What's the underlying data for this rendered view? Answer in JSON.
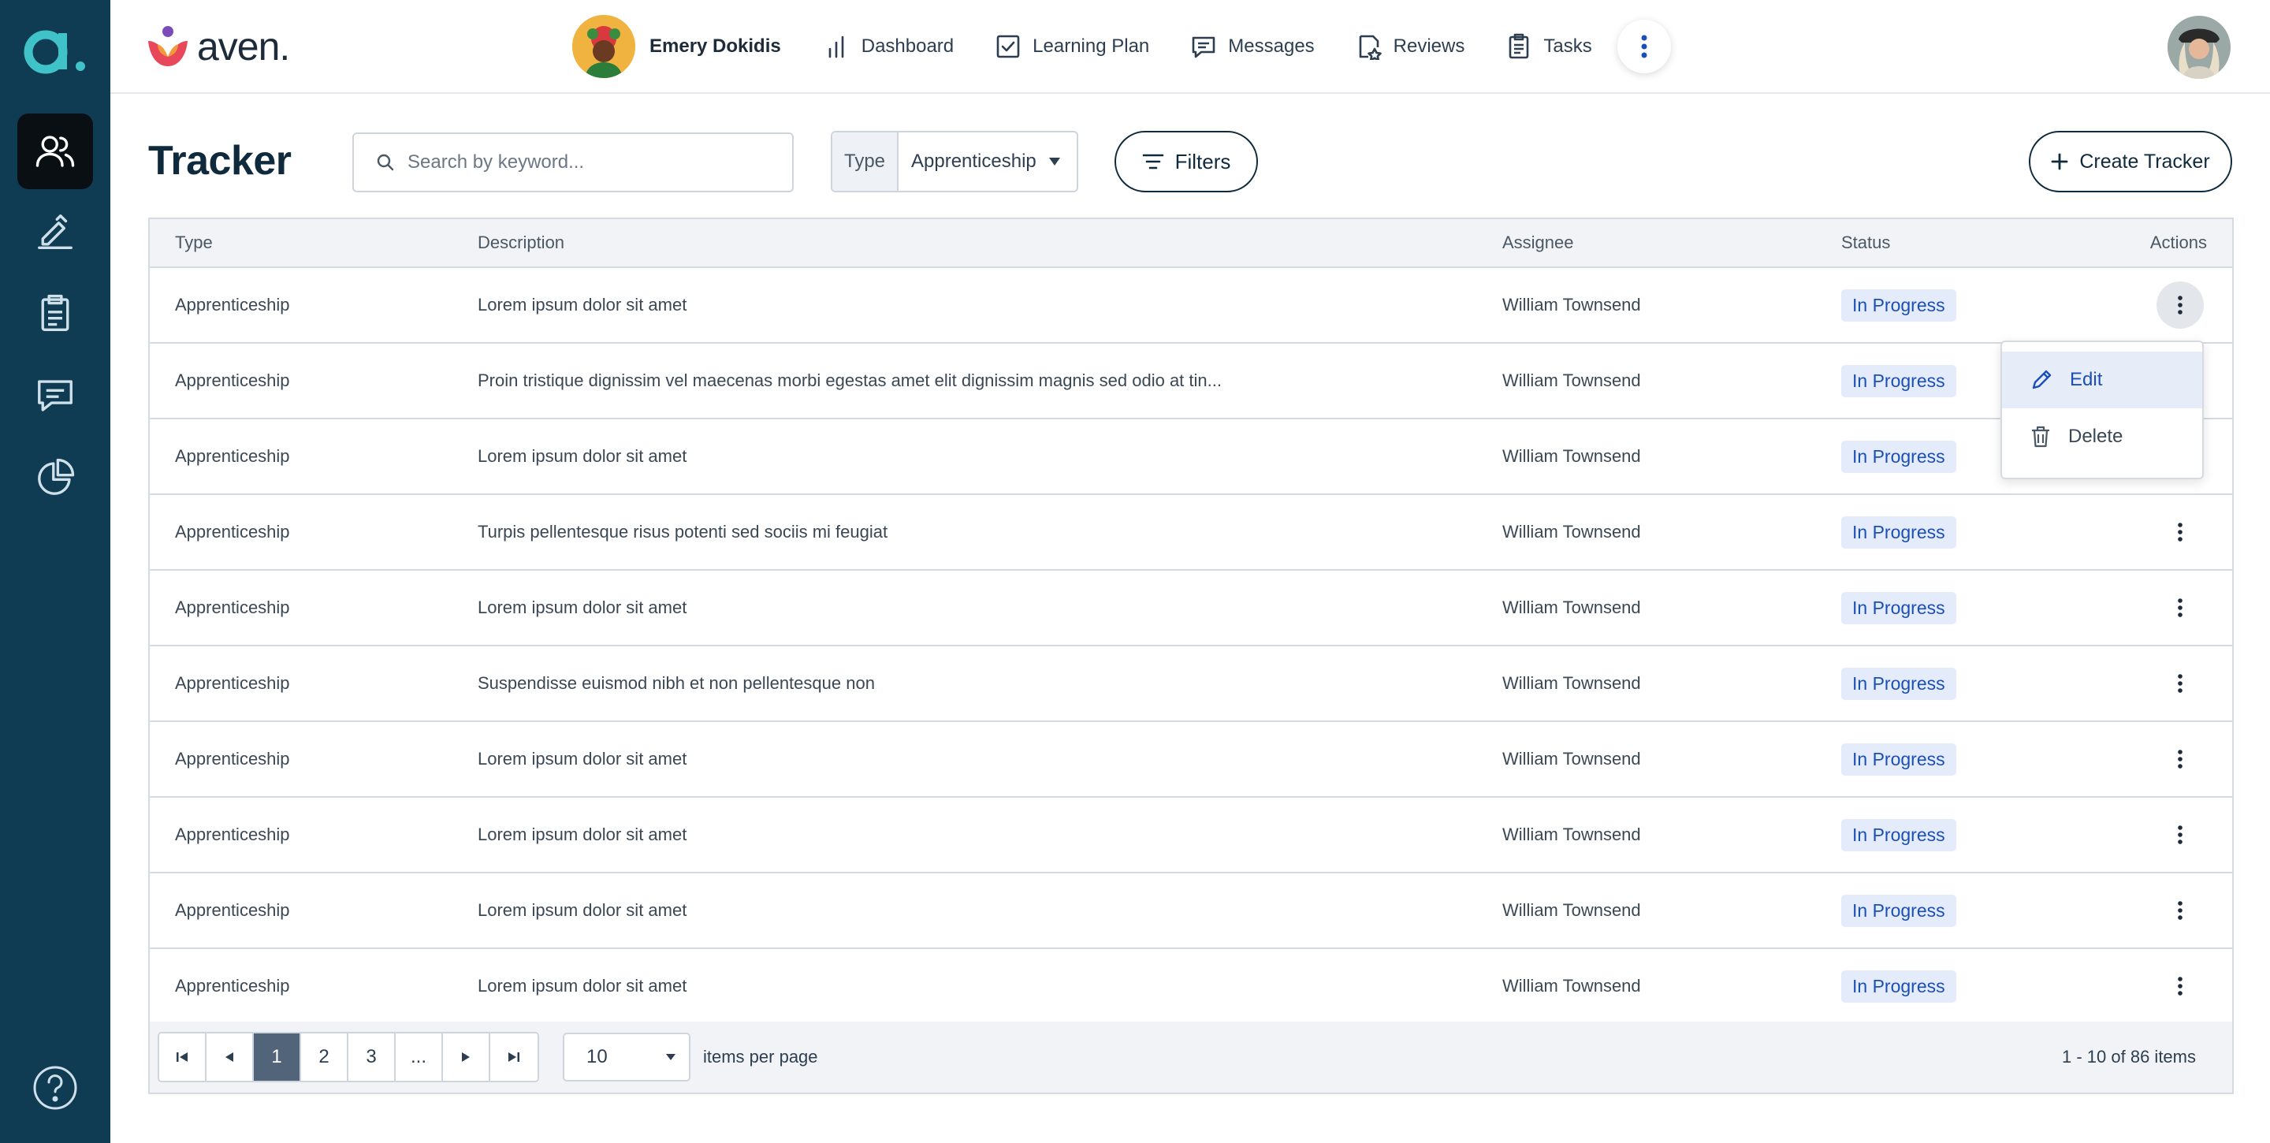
{
  "rail": {
    "items": [
      {
        "icon": "people-icon",
        "active": true
      },
      {
        "icon": "pen-icon",
        "active": false
      },
      {
        "icon": "clipboard-icon",
        "active": false
      },
      {
        "icon": "chat-icon",
        "active": false
      },
      {
        "icon": "pie-chart-icon",
        "active": false
      }
    ]
  },
  "brand": {
    "name": "aven."
  },
  "topnav": {
    "user_name": "Emery Dokidis",
    "items": [
      {
        "label": "Dashboard",
        "icon": "bar-chart-icon"
      },
      {
        "label": "Learning Plan",
        "icon": "checkbox-icon"
      },
      {
        "label": "Messages",
        "icon": "chat-icon"
      },
      {
        "label": "Reviews",
        "icon": "review-icon"
      },
      {
        "label": "Tasks",
        "icon": "clipboard-icon"
      }
    ]
  },
  "toolbar": {
    "title": "Tracker",
    "search_placeholder": "Search by keyword...",
    "type_label": "Type",
    "type_value": "Apprenticeship",
    "filters_label": "Filters",
    "create_label": "Create Tracker"
  },
  "table": {
    "headers": {
      "type": "Type",
      "description": "Description",
      "assignee": "Assignee",
      "status": "Status",
      "actions": "Actions"
    },
    "rows": [
      {
        "type": "Apprenticeship",
        "description": "Lorem ipsum dolor sit amet",
        "assignee": "William Townsend",
        "status": "In Progress"
      },
      {
        "type": "Apprenticeship",
        "description": "Proin tristique dignissim vel maecenas morbi egestas amet elit dignissim magnis sed odio at tin...",
        "assignee": "William Townsend",
        "status": "In Progress"
      },
      {
        "type": "Apprenticeship",
        "description": "Lorem ipsum dolor sit amet",
        "assignee": "William Townsend",
        "status": "In Progress"
      },
      {
        "type": "Apprenticeship",
        "description": "Turpis pellentesque risus potenti sed sociis mi feugiat",
        "assignee": "William Townsend",
        "status": "In Progress"
      },
      {
        "type": "Apprenticeship",
        "description": "Lorem ipsum dolor sit amet",
        "assignee": "William Townsend",
        "status": "In Progress"
      },
      {
        "type": "Apprenticeship",
        "description": "Suspendisse euismod nibh et non pellentesque non",
        "assignee": "William Townsend",
        "status": "In Progress"
      },
      {
        "type": "Apprenticeship",
        "description": "Lorem ipsum dolor sit amet",
        "assignee": "William Townsend",
        "status": "In Progress"
      },
      {
        "type": "Apprenticeship",
        "description": "Lorem ipsum dolor sit amet",
        "assignee": "William Townsend",
        "status": "In Progress"
      },
      {
        "type": "Apprenticeship",
        "description": "Lorem ipsum dolor sit amet",
        "assignee": "William Townsend",
        "status": "In Progress"
      },
      {
        "type": "Apprenticeship",
        "description": "Lorem ipsum dolor sit amet",
        "assignee": "William Townsend",
        "status": "In Progress"
      }
    ]
  },
  "row_menu": {
    "edit_label": "Edit",
    "delete_label": "Delete"
  },
  "pager": {
    "pages": [
      "1",
      "2",
      "3",
      "..."
    ],
    "current": "1",
    "per_page": "10",
    "per_page_label": "items per page",
    "summary": "1 - 10 of 86 items"
  },
  "colors": {
    "rail": "#0f3b53",
    "accent": "#1c4fb5",
    "badge_bg": "#e4ecfb"
  }
}
